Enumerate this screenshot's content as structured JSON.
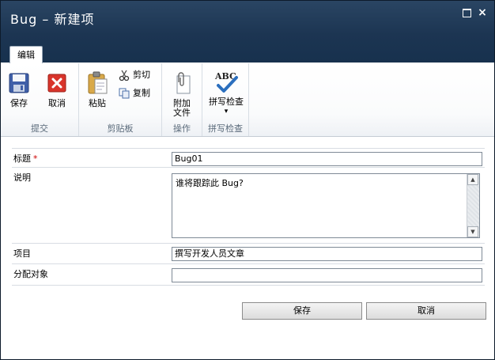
{
  "window": {
    "title": "Bug  –  新建项",
    "maximize_icon": "maximize-icon",
    "close_icon": "close-icon",
    "close_glyph": "×"
  },
  "ribbon": {
    "tab": "编辑",
    "groups": [
      {
        "label": "提交",
        "buttons": [
          {
            "label": "保存",
            "icon": "save-disk-icon"
          },
          {
            "label": "取消",
            "icon": "cancel-x-icon"
          }
        ]
      },
      {
        "label": "剪贴板",
        "buttons": [
          {
            "label": "粘贴",
            "icon": "paste-clipboard-icon"
          },
          {
            "label": "剪切",
            "icon": "scissors-icon"
          },
          {
            "label": "复制",
            "icon": "copy-icon"
          }
        ]
      },
      {
        "label": "操作",
        "buttons": [
          {
            "label": "附加",
            "label2": "文件",
            "icon": "paperclip-icon"
          }
        ]
      },
      {
        "label": "拼写检查",
        "buttons": [
          {
            "label": "拼写检查",
            "icon": "abc-spellcheck-icon",
            "dropdown": "▾",
            "icon_text": "ABC"
          }
        ]
      }
    ]
  },
  "form": {
    "fields": [
      {
        "label": "标题",
        "required_mark": "*",
        "value": "Bug01"
      },
      {
        "label": "说明",
        "value": "谁将跟踪此 Bug?"
      },
      {
        "label": "项目",
        "value": "撰写开发人员文章"
      },
      {
        "label": "分配对象",
        "value": ""
      }
    ],
    "scroll_up": "▲",
    "scroll_down": "▼"
  },
  "footer": {
    "save_label": "保存",
    "cancel_label": "取消"
  }
}
